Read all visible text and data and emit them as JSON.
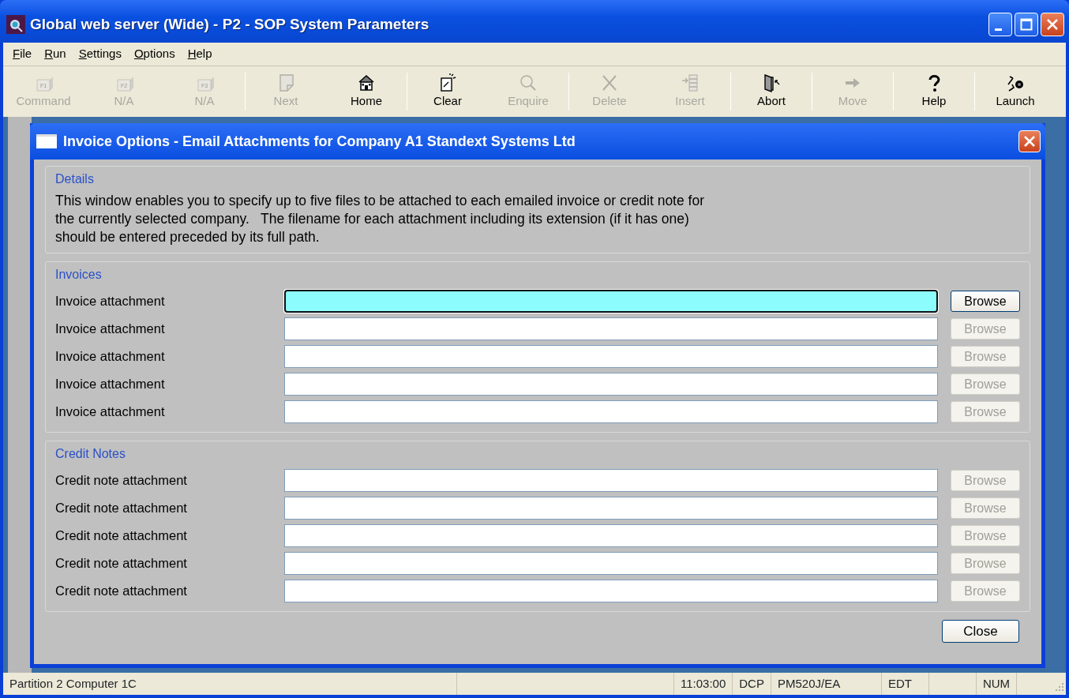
{
  "window": {
    "title": "Global web server (Wide) - P2 - SOP System Parameters"
  },
  "menu": [
    {
      "label": "File"
    },
    {
      "label": "Run"
    },
    {
      "label": "Settings"
    },
    {
      "label": "Options"
    },
    {
      "label": "Help"
    }
  ],
  "toolbar": [
    {
      "kind": "fkey",
      "key": "F1",
      "label": "Command",
      "disabled": true,
      "separator_before": false
    },
    {
      "kind": "fkey",
      "key": "F2",
      "label": "N/A",
      "disabled": true,
      "separator_before": false
    },
    {
      "kind": "fkey",
      "key": "F3",
      "label": "N/A",
      "disabled": true,
      "separator_before": false
    },
    {
      "kind": "page",
      "label": "Next",
      "disabled": true,
      "separator_before": true
    },
    {
      "kind": "house",
      "label": "Home",
      "disabled": false,
      "separator_before": false
    },
    {
      "kind": "spark",
      "label": "Clear",
      "disabled": false,
      "separator_before": true
    },
    {
      "kind": "magnifier",
      "label": "Enquire",
      "disabled": true,
      "separator_before": false
    },
    {
      "kind": "cross",
      "label": "Delete",
      "disabled": true,
      "separator_before": true
    },
    {
      "kind": "stack",
      "label": "Insert",
      "disabled": true,
      "separator_before": false
    },
    {
      "kind": "door",
      "label": "Abort",
      "disabled": false,
      "separator_before": true
    },
    {
      "kind": "arrow",
      "label": "Move",
      "disabled": true,
      "separator_before": true
    },
    {
      "kind": "question",
      "label": "Help",
      "disabled": false,
      "separator_before": true
    },
    {
      "kind": "launch",
      "label": "Launch",
      "disabled": false,
      "separator_before": true
    }
  ],
  "dialog": {
    "title": "Invoice Options - Email Attachments for Company A1 Standext Systems Ltd",
    "details": {
      "heading": "Details",
      "text": "This window enables you to specify up to five files to be attached to each emailed invoice or credit note for the currently selected company.   The filename for each attachment including its extension (if it has one) should be entered preceded by its full path."
    },
    "sections": [
      {
        "heading": "Invoices",
        "rows": [
          {
            "label": "Invoice attachment",
            "focused": true,
            "browse": {
              "label": "Browse",
              "disabled": false
            }
          },
          {
            "label": "Invoice attachment",
            "focused": false,
            "browse": {
              "label": "Browse",
              "disabled": true
            }
          },
          {
            "label": "Invoice attachment",
            "focused": false,
            "browse": {
              "label": "Browse",
              "disabled": true
            }
          },
          {
            "label": "Invoice attachment",
            "focused": false,
            "browse": {
              "label": "Browse",
              "disabled": true
            }
          },
          {
            "label": "Invoice attachment",
            "focused": false,
            "browse": {
              "label": "Browse",
              "disabled": true
            }
          }
        ]
      },
      {
        "heading": "Credit Notes",
        "rows": [
          {
            "label": "Credit note attachment",
            "focused": false,
            "browse": {
              "label": "Browse",
              "disabled": true
            }
          },
          {
            "label": "Credit note attachment",
            "focused": false,
            "browse": {
              "label": "Browse",
              "disabled": true
            }
          },
          {
            "label": "Credit note attachment",
            "focused": false,
            "browse": {
              "label": "Browse",
              "disabled": true
            }
          },
          {
            "label": "Credit note attachment",
            "focused": false,
            "browse": {
              "label": "Browse",
              "disabled": true
            }
          },
          {
            "label": "Credit note attachment",
            "focused": false,
            "browse": {
              "label": "Browse",
              "disabled": true
            }
          }
        ]
      }
    ],
    "close_button": "Close"
  },
  "status_bar": [
    "Partition 2 Computer 1C",
    "11:03:00",
    "DCP",
    "PM520J/EA",
    "EDT",
    "NUM"
  ]
}
